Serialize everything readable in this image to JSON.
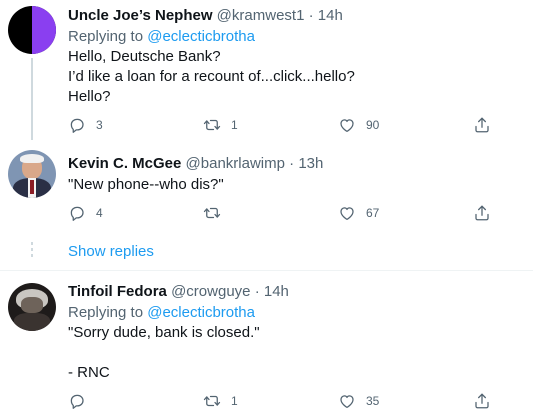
{
  "tweets": [
    {
      "name": "Uncle Joe’s Nephew",
      "handle": "@kramwest1",
      "dot": "·",
      "time": "14h",
      "replying_prefix": "Replying to ",
      "replying_mention": "@eclecticbrotha",
      "lines": [
        "Hello, Deutsche Bank?",
        "I’d like a loan for a recount of...click...hello?",
        "Hello?"
      ],
      "reply_count": "3",
      "retweet_count": "1",
      "like_count": "90"
    },
    {
      "name": "Kevin C. McGee",
      "handle": "@bankrlawimp",
      "dot": "·",
      "time": "13h",
      "lines": [
        "\"New phone--who dis?\""
      ],
      "reply_count": "4",
      "retweet_count": "",
      "like_count": "67"
    },
    {
      "name": "Tinfoil Fedora",
      "handle": "@crowguye",
      "dot": "·",
      "time": "14h",
      "replying_prefix": "Replying to ",
      "replying_mention": "@eclecticbrotha",
      "lines": [
        "\"Sorry dude, bank is closed.\"",
        "",
        "- RNC"
      ],
      "reply_count": "",
      "retweet_count": "1",
      "like_count": "35"
    }
  ],
  "show_replies_label": "Show replies",
  "icons": [
    "reply-icon",
    "retweet-icon",
    "like-icon",
    "share-icon"
  ],
  "colors": {
    "link": "#1d9bf0",
    "muted": "#536471",
    "text": "#0f1419"
  }
}
